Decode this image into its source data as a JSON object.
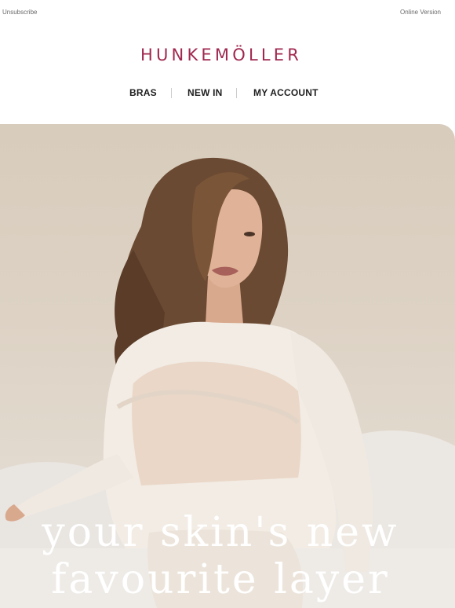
{
  "topbar": {
    "unsubscribe": "Unsubscribe",
    "online_version": "Online Version"
  },
  "brand": {
    "logo": "HUNKEMÖLLER",
    "color": "#a0284f"
  },
  "nav": {
    "items": [
      {
        "label": "BRAS"
      },
      {
        "label": "NEW IN"
      },
      {
        "label": "MY ACCOUNT"
      }
    ]
  },
  "hero": {
    "headline_line1": "your skin's new",
    "headline_line2": "favourite layer",
    "image": "model-in-sheer-top"
  }
}
